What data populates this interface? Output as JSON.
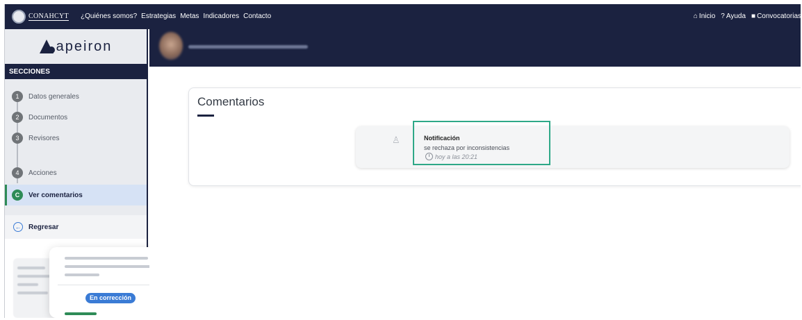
{
  "topbar": {
    "brand": "CONAHCYT",
    "links": [
      "¿Quiénes somos?",
      "Estrategias",
      "Metas",
      "Indicadores",
      "Contacto"
    ],
    "right": {
      "home_icon": "home-icon",
      "home": "Inicio",
      "help_icon": "question-icon",
      "help": "Ayuda",
      "calls_icon": "document-icon",
      "calls": "Convocatorias"
    }
  },
  "sidebar": {
    "logo": "apeiron",
    "sections_header": "SECCIONES",
    "steps": [
      {
        "num": "1",
        "label": "Datos generales"
      },
      {
        "num": "2",
        "label": "Documentos"
      },
      {
        "num": "3",
        "label": "Revisores"
      },
      {
        "num": "4",
        "label": "Acciones"
      },
      {
        "num": "C",
        "label": "Ver comentarios"
      }
    ],
    "back_label": "Regresar",
    "status_badge": "En corrección"
  },
  "main": {
    "title": "Comentarios",
    "comment": {
      "title": "Notificación",
      "text": "se rechaza por inconsistencias",
      "time": "hoy a las 20:21"
    }
  },
  "colors": {
    "navy": "#1b2240",
    "accent_green": "#2e8b57",
    "badge_blue": "#3a7bd5",
    "highlight": "#2ea887"
  }
}
